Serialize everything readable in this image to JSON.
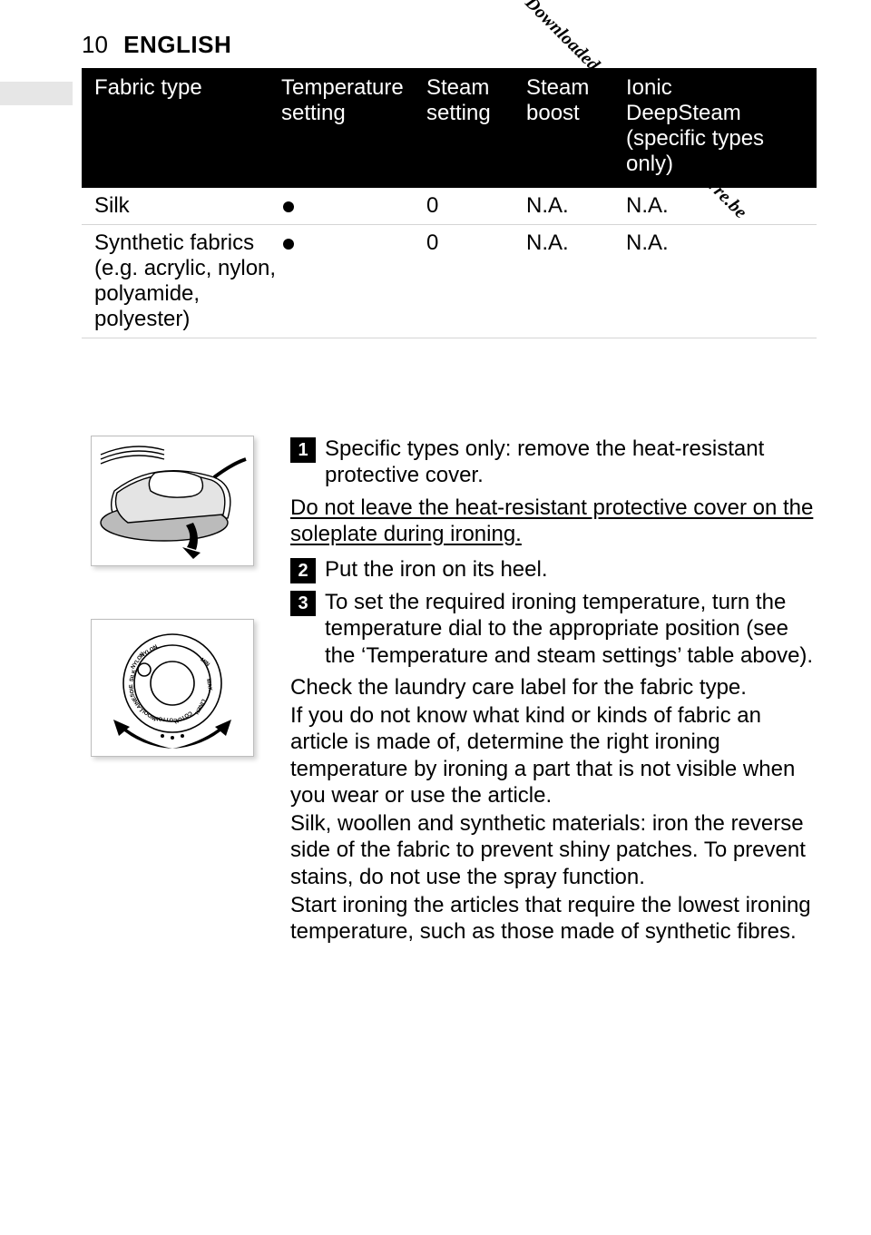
{
  "header": {
    "page_number": "10",
    "language": "ENGLISH"
  },
  "watermark": "Downloaded from www.vandenborre.be",
  "table": {
    "headers": {
      "c1": "Fabric type",
      "c2": "Temperature setting",
      "c3": "Steam setting",
      "c4": "Steam boost",
      "c5": "Ionic DeepSteam (specific types only)"
    },
    "rows": [
      {
        "fabric": "Silk",
        "temp_dot": true,
        "steam": "0",
        "boost": "N.A.",
        "ionic": "N.A."
      },
      {
        "fabric": "Synthetic fabrics (e.g. acrylic, nylon, polyamide, polyester)",
        "temp_dot": true,
        "steam": "0",
        "boost": "N.A.",
        "ionic": "N.A."
      }
    ]
  },
  "steps": {
    "s1": {
      "num": "1",
      "text": "Specific types only: remove the heat-resistant protective cover."
    },
    "s1_warn": "Do not leave the heat-resistant protective cover on the soleplate during ironing.",
    "s2": {
      "num": "2",
      "text": "Put the iron on its heel."
    },
    "s3": {
      "num": "3",
      "text": "To set the required ironing temperature, turn the temperature dial to the appropriate position (see the ‘Temperature and steam settings’ table above)."
    },
    "p1": "Check the laundry care label for the fabric type.",
    "p2": "If you do not know what kind or kinds of fabric an article is made of, determine the right ironing temperature by ironing a part that is not visible when you wear or use the article.",
    "p3": "Silk, woollen and synthetic materials: iron the reverse side of the fabric to prevent shiny patches. To prevent stains, do not use the spray function.",
    "p4": "Start ironing the articles that require the lowest ironing temperature, such as those made of synthetic fibres."
  }
}
